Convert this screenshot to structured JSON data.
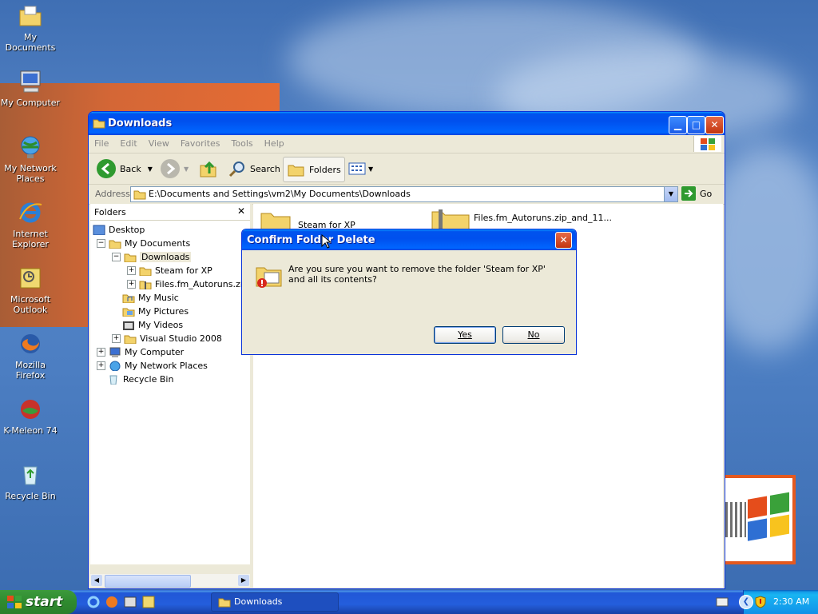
{
  "desktop": {
    "icons": [
      {
        "label": "My Documents"
      },
      {
        "label": "My Computer"
      },
      {
        "label": "My Network Places"
      },
      {
        "label": "Internet Explorer"
      },
      {
        "label": "Microsoft Outlook"
      },
      {
        "label": "Mozilla Firefox"
      },
      {
        "label": "K-Meleon 74"
      },
      {
        "label": "Recycle Bin"
      }
    ]
  },
  "window": {
    "title": "Downloads",
    "menu": [
      "File",
      "Edit",
      "View",
      "Favorites",
      "Tools",
      "Help"
    ],
    "toolbar": {
      "back_label": "Back",
      "search_label": "Search",
      "folders_label": "Folders"
    },
    "address": {
      "label": "Address",
      "value": "E:\\Documents and Settings\\vm2\\My Documents\\Downloads",
      "go_label": "Go"
    },
    "folders_pane": {
      "title": "Folders",
      "close_glyph": "✕",
      "tree": [
        {
          "label": "Desktop",
          "expander": ""
        },
        {
          "label": "My Documents",
          "expander": "−"
        },
        {
          "label": "Downloads",
          "expander": "−"
        },
        {
          "label": "Steam for XP",
          "expander": "+"
        },
        {
          "label": "Files.fm_Autoruns.zip_",
          "expander": "+"
        },
        {
          "label": "My Music",
          "expander": ""
        },
        {
          "label": "My Pictures",
          "expander": ""
        },
        {
          "label": "My Videos",
          "expander": ""
        },
        {
          "label": "Visual Studio 2008",
          "expander": "+"
        },
        {
          "label": "My Computer",
          "expander": "+"
        },
        {
          "label": "My Network Places",
          "expander": "+"
        },
        {
          "label": "Recycle Bin",
          "expander": ""
        }
      ]
    },
    "files": [
      {
        "name": "Steam for XP"
      },
      {
        "name": "Files.fm_Autoruns.zip_and_11..."
      }
    ]
  },
  "dialog": {
    "title": "Confirm Folder Delete",
    "message": "Are you sure you want to remove the folder 'Steam for XP' and all its contents?",
    "yes_label": "Yes",
    "no_label": "No"
  },
  "taskbar": {
    "start_label": "start",
    "task_label": "Downloads",
    "clock": "2:30 AM"
  },
  "colors": {
    "title_blue": "#0050ee",
    "start_green": "#2f8a2f",
    "selection_bg": "#ece9d8"
  }
}
